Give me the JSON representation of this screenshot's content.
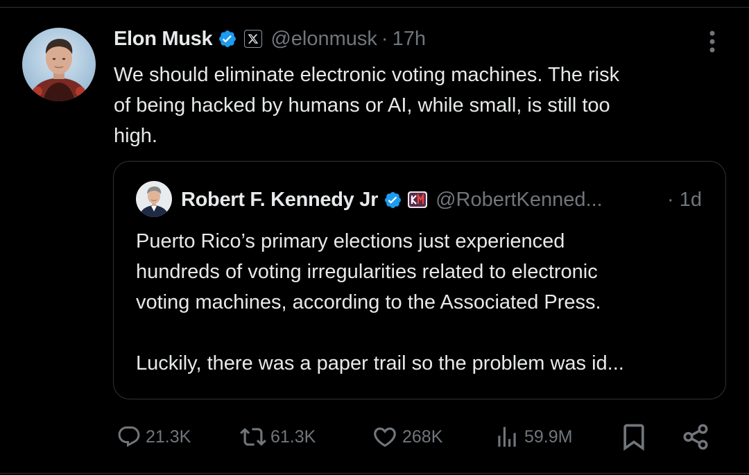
{
  "tweet": {
    "author": {
      "name": "Elon Musk",
      "handle": "@elonmusk",
      "verified_color": "#1d9bf0",
      "affiliation_icon": "x-logo-icon"
    },
    "separator": "·",
    "time": "17h",
    "text_lines": [
      "We should eliminate electronic voting machines. The risk",
      "of being hacked by humans or AI, while small, is still too",
      "high."
    ]
  },
  "quote": {
    "author": {
      "name": "Robert F. Kennedy Jr",
      "handle": "@RobertKenned...",
      "verified_color": "#1d9bf0",
      "affiliation_icon": "campaign-badge-icon"
    },
    "time": "· 1d",
    "text_lines": [
      "Puerto Rico’s primary elections just experienced",
      "hundreds of voting irregularities related to electronic",
      "voting machines, according to the Associated Press.",
      "",
      "Luckily, there was a paper trail so the problem was id..."
    ]
  },
  "actions": {
    "replies": "21.3K",
    "reposts": "61.3K",
    "likes": "268K",
    "views": "59.9M"
  },
  "colors": {
    "background": "#000000",
    "text_primary": "#e7e9ea",
    "text_secondary": "#71767b",
    "border": "#2f3336",
    "accent": "#1d9bf0"
  }
}
